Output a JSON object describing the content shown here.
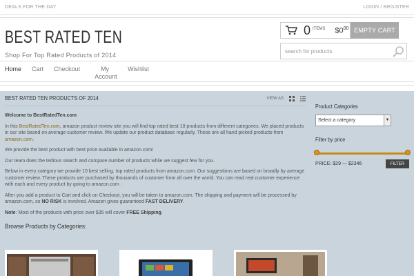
{
  "topbar": {
    "left": "DEALS FOR THE DAY",
    "right": "LOGIN / REGISTER"
  },
  "brand": {
    "title": "BEST RATED TEN",
    "tagline": "Shop For Top Rated Products of 2014"
  },
  "cart": {
    "count": "0",
    "items_label": "ITEMS",
    "currency": "$",
    "price": "0",
    "cents": "00",
    "empty_label": "EMPTY CART"
  },
  "search": {
    "placeholder": "search for products"
  },
  "nav": [
    "Home",
    "Cart",
    "Checkout",
    "My Account",
    "Wishlist"
  ],
  "main": {
    "heading": "BEST RATED TEN PRODUCTS OF 2014",
    "view_as": "VIEW AS",
    "welcome": "Welcome to BestRatedTen.com",
    "p1_pre": "In this ",
    "p1_link": "BestRatedTen.com",
    "p1_post": ", amazon product review site you will find top rated best 10 products from different categories. We placed products in our site based on average customer review. We update our product database regularly. These are all hand picked products from ",
    "p1_link2": "amazon.com",
    "p1_end": ".",
    "p2": "We provide the best product with best price available in amazon.com!",
    "p3": "Our team does the tedious search and compare number of products while we suggest few for you.",
    "p4": "Below in every category we provide 10 best selling, top rated products from amazon.com. Our suggestions are based on broadly by average customer review. These products are purchased by thousands of customer from all over the world. You can read real customer experience with each and every product by going to amazon.com .",
    "p5_pre": "After you add a product to Cart and click on Checkout, you will be taken to amazon.com. The shipping and payment will be processed by amazon.com, so ",
    "p5_bold": "NO RISK",
    "p5_mid": " is involved. Amazon gives guaranteed ",
    "p5_bold2": "FAST DELIVERY",
    "p5_end": ".",
    "note_label": "Note",
    "note_text": ": Most of the products with price over $35 will cover ",
    "note_bold": "FREE Shipping",
    "note_end": ".",
    "browse": "Browse Products by Categories:"
  },
  "sidebar": {
    "categories_heading": "Product Categories",
    "select_value": "Select a category",
    "filter_heading": "Filter by price",
    "price_label": "PRICE: $29 — $2346",
    "filter_button": "FILTER",
    "price_min": 29,
    "price_max": 2346
  },
  "colors": {
    "accent": "#d99519",
    "content_bg": "#c9d4dc",
    "cart_button": "#aaaaaa"
  }
}
